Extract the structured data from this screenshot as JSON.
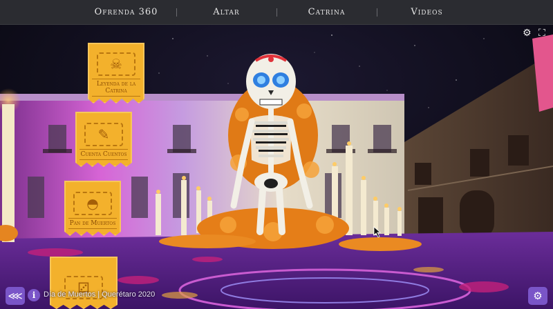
{
  "nav": {
    "items": [
      {
        "label": "Ofrenda 360"
      },
      {
        "label": "Altar"
      },
      {
        "label": "Catrina"
      },
      {
        "label": "Videos"
      }
    ]
  },
  "menu": {
    "cards": [
      {
        "label": "Leyenda de la Catrina",
        "icon": "skull-icon"
      },
      {
        "label": "Cuenta Cuentos",
        "icon": "book-icon"
      },
      {
        "label": "Pan de Muertos",
        "icon": "bread-icon"
      },
      {
        "label": "",
        "icon": "puzzle-icon"
      }
    ]
  },
  "toolbar": {
    "settings_icon": "⚙",
    "fullscreen_icon": "⛶",
    "share_icon": "⋘",
    "info_icon": "i"
  },
  "footer": {
    "caption": "Día de Muertos | Querétaro 2020"
  },
  "colors": {
    "accent": "#7a55c8",
    "marigold": "#f08a1c",
    "papel": "#f3b12c",
    "nav_bg": "#2b2c31"
  }
}
